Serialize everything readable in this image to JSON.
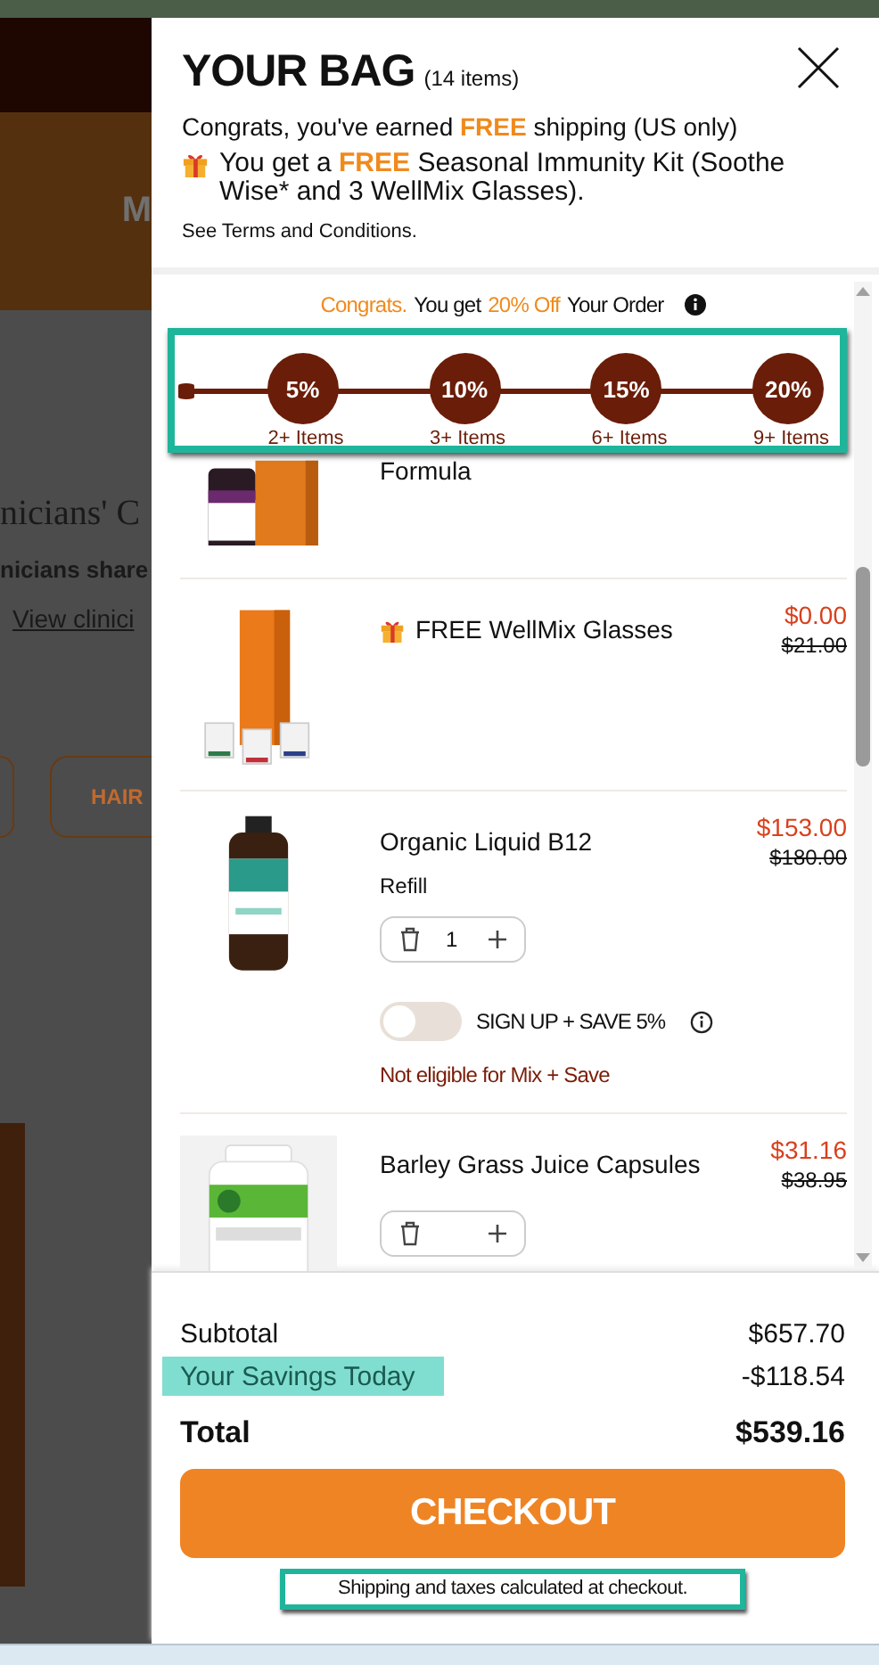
{
  "background": {
    "banner_letter": "M",
    "heading": "nicians' C",
    "text": "nicians share",
    "link": "View clinici",
    "category_button": "HAIR"
  },
  "bag": {
    "title": "YOUR BAG",
    "count": "(14 items)",
    "shipping_message": "Congrats, you've earned **FREE** shipping (US only)",
    "gift_message": "You get a **FREE** Seasonal Immunity Kit (Soothe Wise* and 3 WellMix Glasses).",
    "terms": "See Terms and Conditions."
  },
  "promo": {
    "parts": [
      {
        "text": "Congrats.",
        "highlight": true
      },
      {
        "text": "You get",
        "highlight": false
      },
      {
        "text": "20% Off",
        "highlight": true
      },
      {
        "text": "Your Order",
        "highlight": false
      }
    ]
  },
  "tiers": [
    {
      "percent": "5%",
      "label": "2+ Items",
      "reached": true
    },
    {
      "percent": "10%",
      "label": "3+ Items",
      "reached": true
    },
    {
      "percent": "15%",
      "label": "6+ Items",
      "reached": true
    },
    {
      "percent": "20%",
      "label": "9+ Items",
      "reached": true
    }
  ],
  "items": [
    {
      "kind": "clipped",
      "name": "Formula"
    },
    {
      "kind": "gift",
      "name": "FREE WellMix Glasses",
      "price": "$0.00",
      "original_price": "$21.00"
    },
    {
      "kind": "product",
      "name": "Organic Liquid B12",
      "variant": "Refill",
      "quantity": "1",
      "price": "$153.00",
      "original_price": "$180.00",
      "subscription": {
        "label": "SIGN UP + SAVE 5%",
        "on": false
      },
      "note": "Not eligible for Mix + Save"
    },
    {
      "kind": "product",
      "name": "Barley Grass Juice Capsules",
      "price": "$31.16",
      "original_price": "$38.95"
    }
  ],
  "summary": {
    "subtotal_label": "Subtotal",
    "subtotal": "$657.70",
    "savings_label": "Your Savings Today",
    "savings": "-$118.54",
    "total_label": "Total",
    "total": "$539.16"
  },
  "checkout_button": "CHECKOUT",
  "checkout_note": "Shipping and taxes calculated at checkout."
}
